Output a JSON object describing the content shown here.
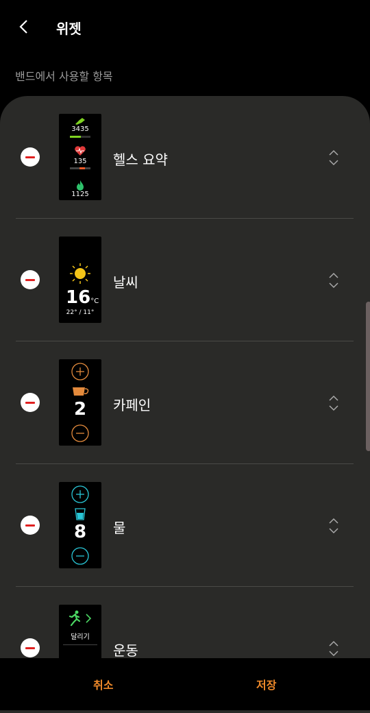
{
  "header": {
    "title": "위젯"
  },
  "section_label": "밴드에서 사용할 항목",
  "items": [
    {
      "label": "헬스 요약",
      "thumb": {
        "steps": "3435",
        "heart": "135",
        "calories": "1125"
      }
    },
    {
      "label": "날씨",
      "thumb": {
        "temp": "16",
        "unit": "°C",
        "range": "22° / 11°"
      }
    },
    {
      "label": "카페인",
      "thumb": {
        "count": "2"
      }
    },
    {
      "label": "물",
      "thumb": {
        "count": "8"
      }
    },
    {
      "label": "운동",
      "thumb": {
        "activity": "달리기"
      }
    }
  ],
  "footer": {
    "cancel_label": "취소",
    "save_label": "저장"
  },
  "colors": {
    "accent": "#f08a2a",
    "remove": "#e02020",
    "steps": "#7ed321",
    "caffeine": "#e38a3c",
    "water": "#29c6d6"
  },
  "icons": [
    "back-arrow-icon",
    "minus-icon",
    "reorder-icon",
    "shoe-icon",
    "heart-icon",
    "flame-icon",
    "sun-icon",
    "plus-icon",
    "cup-icon",
    "glass-icon",
    "runner-icon"
  ]
}
